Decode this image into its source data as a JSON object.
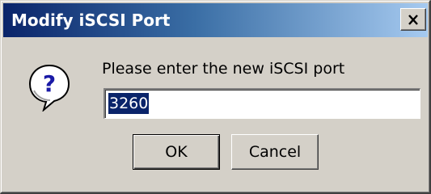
{
  "window": {
    "title": "Modify iSCSI Port",
    "close_icon": "close-icon"
  },
  "dialog": {
    "icon": "question-icon",
    "prompt": "Please enter the new iSCSI port",
    "port_value": "3260"
  },
  "buttons": {
    "ok_label": "OK",
    "cancel_label": "Cancel"
  },
  "colors": {
    "titlebar_start": "#0a246a",
    "titlebar_end": "#a6caf0",
    "face": "#d4d0c8",
    "selection": "#0a246a"
  }
}
